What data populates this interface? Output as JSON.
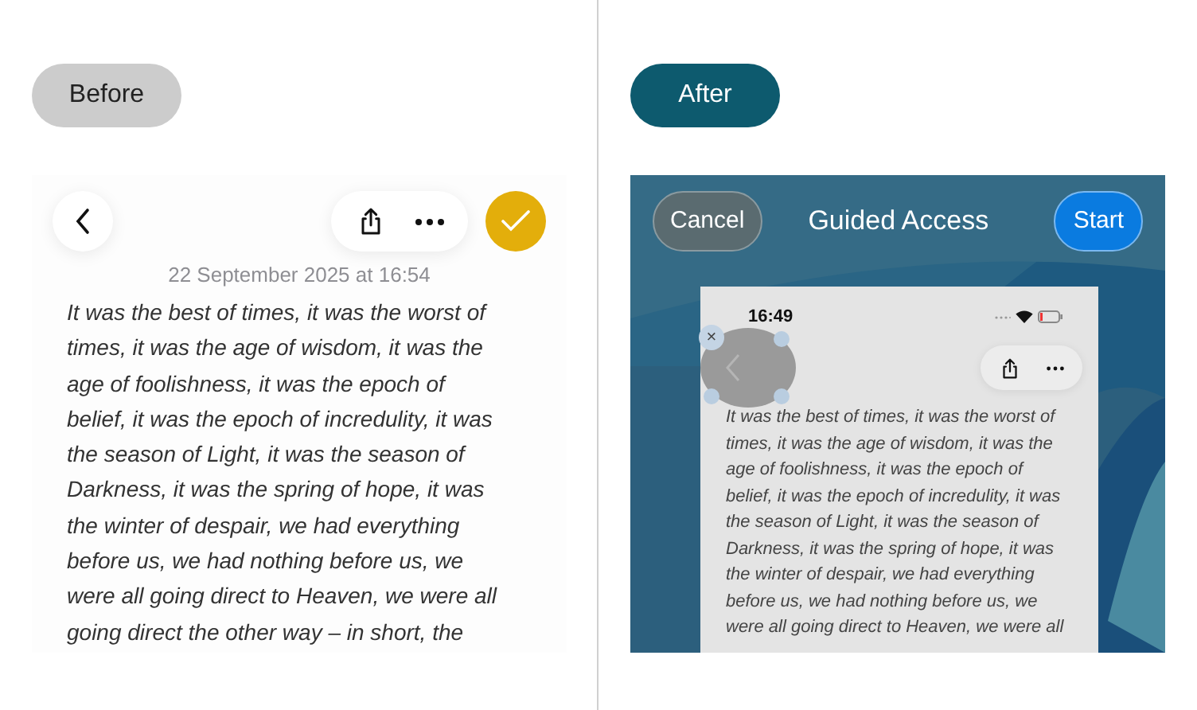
{
  "before": {
    "label": "Before",
    "date": "22 September 2025 at 16:54",
    "lines": [
      "It was the best of times, it was the worst of",
      "times, it was the age of wisdom, it was the",
      "age of foolishness, it was the epoch of",
      "belief, it was the epoch of incredulity, it was",
      "the season of Light, it was the season of",
      "Darkness, it was the spring of hope, it was",
      "the winter of despair, we had everything",
      "before us, we had nothing before us, we",
      "were all going direct to Heaven, we were all",
      "going direct the other way – in short, the"
    ]
  },
  "after": {
    "label": "After",
    "cancel": "Cancel",
    "title": "Guided Access",
    "start": "Start",
    "time": "16:49",
    "close": "×",
    "lines": [
      "It was the best of times, it was the worst of",
      "times, it was the age of wisdom, it was the",
      "age of foolishness, it was the epoch of",
      "belief, it was the epoch of incredulity, it was",
      "the season of Light, it was the season of",
      "Darkness, it was the spring of hope, it was",
      "the winter of despair, we had everything",
      "before us, we had nothing before us, we",
      "were all going direct to Heaven, we were all"
    ]
  }
}
